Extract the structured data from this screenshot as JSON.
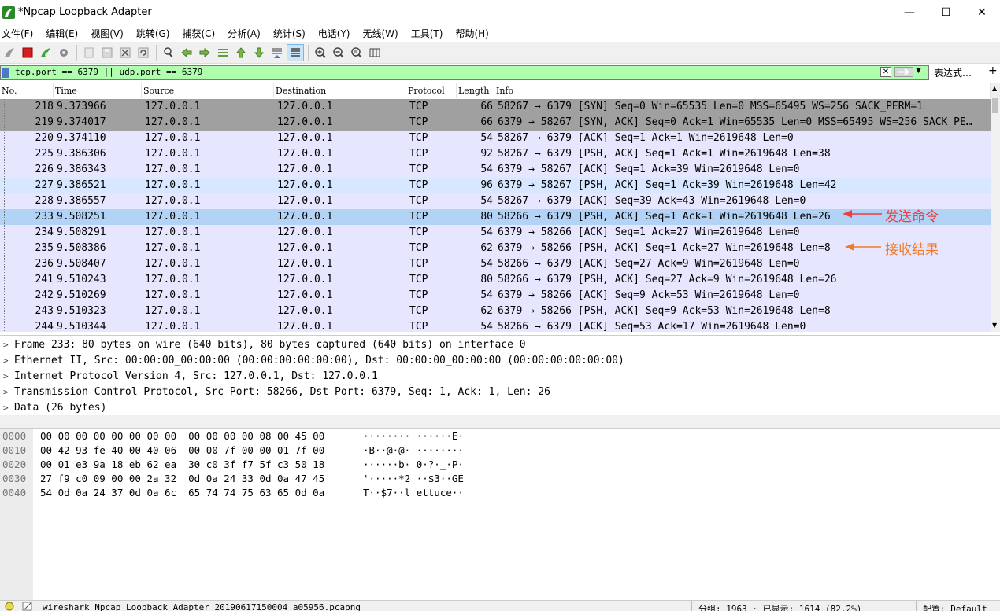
{
  "window": {
    "title": "*Npcap Loopback Adapter",
    "minimize": "—",
    "maximize": "☐",
    "close": "✕"
  },
  "menu": [
    "文件(F)",
    "编辑(E)",
    "视图(V)",
    "跳转(G)",
    "捕获(C)",
    "分析(A)",
    "统计(S)",
    "电话(Y)",
    "无线(W)",
    "工具(T)",
    "帮助(H)"
  ],
  "toolbar": {
    "icons": [
      "shark-fin-icon",
      "stop-icon",
      "restart-icon",
      "options-gear-icon",
      "open-file-icon",
      "save-file-icon",
      "close-file-icon",
      "reload-icon",
      "find-icon",
      "go-back-icon",
      "go-forward-icon",
      "go-to-packet-icon",
      "first-packet-icon",
      "last-packet-icon",
      "autoscroll-icon",
      "colorize-icon",
      "zoom-in-icon",
      "zoom-out-icon",
      "normal-size-icon",
      "resize-columns-icon"
    ],
    "selected": "colorize-icon"
  },
  "filter": {
    "value": "tcp.port == 6379 || udp.port == 6379",
    "expression_label": "表达式…",
    "plus": "+",
    "clear": "✕"
  },
  "packet_list": {
    "columns": [
      "No.",
      "Time",
      "Source",
      "Destination",
      "Protocol",
      "Length",
      "Info"
    ],
    "rows": [
      {
        "no": "218",
        "time": "9.373966",
        "src": "127.0.0.1",
        "dst": "127.0.0.1",
        "proto": "TCP",
        "len": "66",
        "info": "58267 → 6379 [SYN] Seq=0 Win=65535 Len=0 MSS=65495 WS=256 SACK_PERM=1",
        "style": "syn"
      },
      {
        "no": "219",
        "time": "9.374017",
        "src": "127.0.0.1",
        "dst": "127.0.0.1",
        "proto": "TCP",
        "len": "66",
        "info": "6379 → 58267 [SYN, ACK] Seq=0 Ack=1 Win=65535 Len=0 MSS=65495 WS=256 SACK_PE…",
        "style": "syn"
      },
      {
        "no": "220",
        "time": "9.374110",
        "src": "127.0.0.1",
        "dst": "127.0.0.1",
        "proto": "TCP",
        "len": "54",
        "info": "58267 → 6379 [ACK] Seq=1 Ack=1 Win=2619648 Len=0",
        "style": ""
      },
      {
        "no": "225",
        "time": "9.386306",
        "src": "127.0.0.1",
        "dst": "127.0.0.1",
        "proto": "TCP",
        "len": "92",
        "info": "58267 → 6379 [PSH, ACK] Seq=1 Ack=1 Win=2619648 Len=38",
        "style": ""
      },
      {
        "no": "226",
        "time": "9.386343",
        "src": "127.0.0.1",
        "dst": "127.0.0.1",
        "proto": "TCP",
        "len": "54",
        "info": "6379 → 58267 [ACK] Seq=1 Ack=39 Win=2619648 Len=0",
        "style": ""
      },
      {
        "no": "227",
        "time": "9.386521",
        "src": "127.0.0.1",
        "dst": "127.0.0.1",
        "proto": "TCP",
        "len": "96",
        "info": "6379 → 58267 [PSH, ACK] Seq=1 Ack=39 Win=2619648 Len=42",
        "style": "hl"
      },
      {
        "no": "228",
        "time": "9.386557",
        "src": "127.0.0.1",
        "dst": "127.0.0.1",
        "proto": "TCP",
        "len": "54",
        "info": "58267 → 6379 [ACK] Seq=39 Ack=43 Win=2619648 Len=0",
        "style": ""
      },
      {
        "no": "233",
        "time": "9.508251",
        "src": "127.0.0.1",
        "dst": "127.0.0.1",
        "proto": "TCP",
        "len": "80",
        "info": "58266 → 6379 [PSH, ACK] Seq=1 Ack=1 Win=2619648 Len=26",
        "style": "sel"
      },
      {
        "no": "234",
        "time": "9.508291",
        "src": "127.0.0.1",
        "dst": "127.0.0.1",
        "proto": "TCP",
        "len": "54",
        "info": "6379 → 58266 [ACK] Seq=1 Ack=27 Win=2619648 Len=0",
        "style": ""
      },
      {
        "no": "235",
        "time": "9.508386",
        "src": "127.0.0.1",
        "dst": "127.0.0.1",
        "proto": "TCP",
        "len": "62",
        "info": "6379 → 58266 [PSH, ACK] Seq=1 Ack=27 Win=2619648 Len=8",
        "style": ""
      },
      {
        "no": "236",
        "time": "9.508407",
        "src": "127.0.0.1",
        "dst": "127.0.0.1",
        "proto": "TCP",
        "len": "54",
        "info": "58266 → 6379 [ACK] Seq=27 Ack=9 Win=2619648 Len=0",
        "style": ""
      },
      {
        "no": "241",
        "time": "9.510243",
        "src": "127.0.0.1",
        "dst": "127.0.0.1",
        "proto": "TCP",
        "len": "80",
        "info": "58266 → 6379 [PSH, ACK] Seq=27 Ack=9 Win=2619648 Len=26",
        "style": ""
      },
      {
        "no": "242",
        "time": "9.510269",
        "src": "127.0.0.1",
        "dst": "127.0.0.1",
        "proto": "TCP",
        "len": "54",
        "info": "6379 → 58266 [ACK] Seq=9 Ack=53 Win=2619648 Len=0",
        "style": ""
      },
      {
        "no": "243",
        "time": "9.510323",
        "src": "127.0.0.1",
        "dst": "127.0.0.1",
        "proto": "TCP",
        "len": "62",
        "info": "6379 → 58266 [PSH, ACK] Seq=9 Ack=53 Win=2619648 Len=8",
        "style": ""
      },
      {
        "no": "244",
        "time": "9.510344",
        "src": "127.0.0.1",
        "dst": "127.0.0.1",
        "proto": "TCP",
        "len": "54",
        "info": "58266 → 6379 [ACK] Seq=53 Ack=17 Win=2619648 Len=0",
        "style": ""
      }
    ]
  },
  "annotations": {
    "send": "发送命令",
    "receive": "接收结果"
  },
  "details": [
    "Frame 233: 80 bytes on wire (640 bits), 80 bytes captured (640 bits) on interface 0",
    "Ethernet II, Src: 00:00:00_00:00:00 (00:00:00:00:00:00), Dst: 00:00:00_00:00:00 (00:00:00:00:00:00)",
    "Internet Protocol Version 4, Src: 127.0.0.1, Dst: 127.0.0.1",
    "Transmission Control Protocol, Src Port: 58266, Dst Port: 6379, Seq: 1, Ack: 1, Len: 26",
    "Data (26 bytes)"
  ],
  "hex": [
    {
      "off": "0000",
      "bytes": "00 00 00 00 00 00 00 00  00 00 00 00 08 00 45 00",
      "ascii": "········ ······E·"
    },
    {
      "off": "0010",
      "bytes": "00 42 93 fe 40 00 40 06  00 00 7f 00 00 01 7f 00",
      "ascii": "·B··@·@· ········"
    },
    {
      "off": "0020",
      "bytes": "00 01 e3 9a 18 eb 62 ea  30 c0 3f f7 5f c3 50 18",
      "ascii": "······b· 0·?·_·P·"
    },
    {
      "off": "0030",
      "bytes": "27 f9 c0 09 00 00 2a 32  0d 0a 24 33 0d 0a 47 45",
      "ascii": "'·····*2 ··$3··GE"
    },
    {
      "off": "0040",
      "bytes": "54 0d 0a 24 37 0d 0a 6c  65 74 74 75 63 65 0d 0a",
      "ascii": "T··$7··l ettuce··"
    }
  ],
  "status": {
    "file": "wireshark_Npcap Loopback Adapter_20190617150004_a05956.pcapng",
    "packets": "分组: 1963 · 已显示: 1614 (82.2%)",
    "profile": "配置: Default"
  },
  "colors": {
    "filter_ok": "#afffaf",
    "row_default": "#e7e6ff",
    "row_syn": "#a0a0a0",
    "row_selected": "#b3d3f6",
    "annot_send": "#ea4040",
    "annot_receive": "#f07a28"
  }
}
